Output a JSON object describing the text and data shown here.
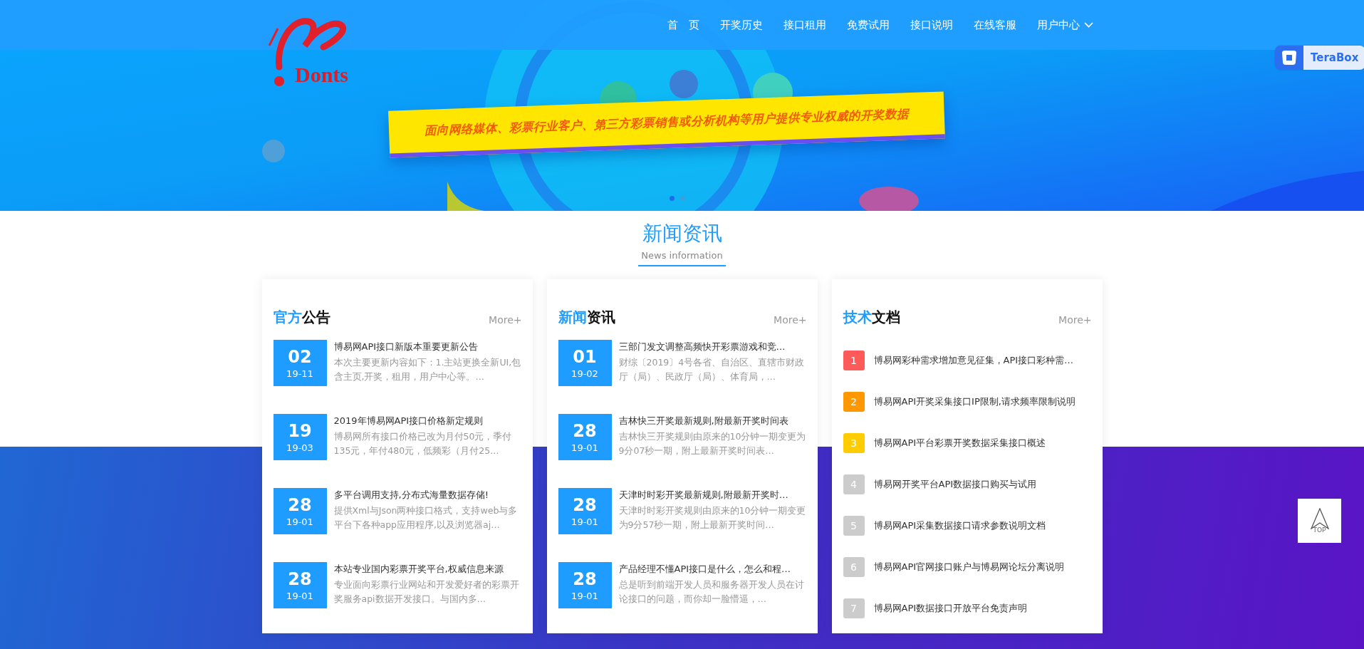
{
  "header": {
    "logo_text": "Donts",
    "nav": [
      {
        "label": "首　页",
        "dropdown": false
      },
      {
        "label": "开奖历史",
        "dropdown": false
      },
      {
        "label": "接口租用",
        "dropdown": false
      },
      {
        "label": "免费试用",
        "dropdown": false
      },
      {
        "label": "接口说明",
        "dropdown": false
      },
      {
        "label": "在线客服",
        "dropdown": false
      },
      {
        "label": "用户中心",
        "dropdown": true
      }
    ]
  },
  "banner": {
    "slogan": "面向网络媒体、彩票行业客户、第三方彩票销售或分析机构等用户提供专业权威的开奖数据",
    "dots": [
      {
        "selected": true
      },
      {
        "selected": false
      }
    ]
  },
  "section": {
    "title": "新闻资讯",
    "subtitle": "News information"
  },
  "cards": [
    {
      "kind": "dated",
      "heading_accent": "官方",
      "heading_rest": "公告",
      "more": "More+",
      "items": [
        {
          "day": "02",
          "month": "19-11",
          "title": "博易网API接口新版本重要更新公告",
          "desc": "本次主要更新内容如下：1.主站更换全新UI,包含主页,开奖，租用，用户中心等。…"
        },
        {
          "day": "19",
          "month": "19-03",
          "title": "2019年博易网API接口价格新定规则",
          "desc": "博易网所有接口价格已改为月付50元，季付135元，年付480元，低频彩（月付25…"
        },
        {
          "day": "28",
          "month": "19-01",
          "title": "多平台调用支持,分布式海量数据存储!",
          "desc": "提供Xml与Json两种接口格式，支持web与多平台下各种app应用程序,以及浏览器aj…"
        },
        {
          "day": "28",
          "month": "19-01",
          "title": "本站专业国内彩票开奖平台,权威信息来源",
          "desc": "专业面向彩票行业网站和开发爱好者的彩票开奖服务api数据开发接口。与国内多…"
        }
      ]
    },
    {
      "kind": "dated",
      "heading_accent": "新闻",
      "heading_rest": "资讯",
      "more": "More+",
      "items": [
        {
          "day": "01",
          "month": "19-02",
          "title": "三部门发文调整高频快开彩票游戏和竞…",
          "desc": "财综〔2019〕4号各省、自治区、直辖市财政厅（局）、民政厅（局）、体育局，…"
        },
        {
          "day": "28",
          "month": "19-01",
          "title": "吉林快三开奖最新规则,附最新开奖时间表",
          "desc": "吉林快三开奖规则由原来的10分钟一期变更为9分07秒一期，附上最新开奖时间表…"
        },
        {
          "day": "28",
          "month": "19-01",
          "title": "天津时时彩开奖最新规则,附最新开奖时…",
          "desc": "天津时时彩开奖规则由原来的10分钟一期变更为9分57秒一期，附上最新开奖时间…"
        },
        {
          "day": "28",
          "month": "19-01",
          "title": "产品经理不懂API接口是什么，怎么和程…",
          "desc": "总是听到前端开发人员和服务器开发人员在讨论接口的问题，而你却一脸懵逼，…"
        }
      ]
    },
    {
      "kind": "ranked",
      "heading_accent": "技术",
      "heading_rest": "文档",
      "more": "More+",
      "items": [
        {
          "rank": "1",
          "color": "#ff5a5a",
          "title": "博易网彩种需求增加意见征集，API接口彩种需…"
        },
        {
          "rank": "2",
          "color": "#ff9800",
          "title": "博易网API开奖采集接口IP限制,请求频率限制说明"
        },
        {
          "rank": "3",
          "color": "#ffcc00",
          "title": "博易网API平台彩票开奖数据采集接口概述"
        },
        {
          "rank": "4",
          "color": "#cccccc",
          "title": "博易网开奖平台API数据接口购买与试用"
        },
        {
          "rank": "5",
          "color": "#cccccc",
          "title": "博易网API采集数据接口请求参数说明文档"
        },
        {
          "rank": "6",
          "color": "#cccccc",
          "title": "博易网API官网接口账户与博易网论坛分离说明"
        },
        {
          "rank": "7",
          "color": "#cccccc",
          "title": "博易网API数据接口开放平台免责声明"
        }
      ]
    }
  ],
  "widgets": {
    "terabox": "TeraBox",
    "top": "TOP"
  }
}
